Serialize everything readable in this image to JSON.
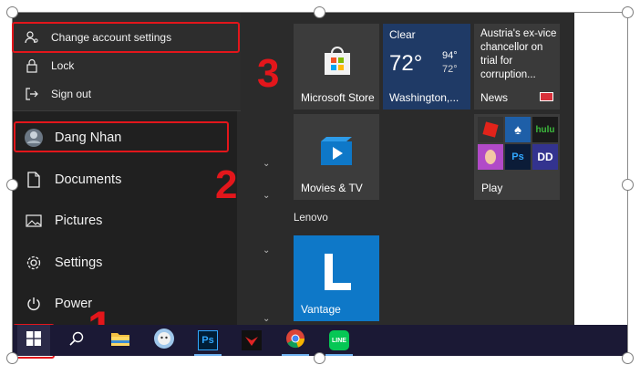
{
  "account_menu": {
    "change_settings": "Change account settings",
    "lock": "Lock",
    "sign_out": "Sign out"
  },
  "left_items": {
    "user": "Dang Nhan",
    "documents": "Documents",
    "pictures": "Pictures",
    "settings": "Settings",
    "power": "Power"
  },
  "annotations": {
    "one": "1",
    "two": "2",
    "three": "3"
  },
  "tiles": {
    "store": "Microsoft Store",
    "weather": {
      "condition": "Clear",
      "temp": "72°",
      "high": "94°",
      "low": "72°",
      "location": "Washington,..."
    },
    "news": {
      "headline": "Austria's ex-vice chancellor on trial for corruption...",
      "source": "News"
    },
    "movies": "Movies & TV",
    "play": "Play",
    "play_apps": [
      "Roblox",
      "Solitaire",
      "hulu",
      "Game",
      "Ps",
      "Dolby"
    ],
    "vantage": "Vantage"
  },
  "group_label": "Lenovo",
  "colors": {
    "highlight": "#e3161b",
    "taskbar": "#1b1935",
    "tile_blue": "#0e78c8"
  }
}
